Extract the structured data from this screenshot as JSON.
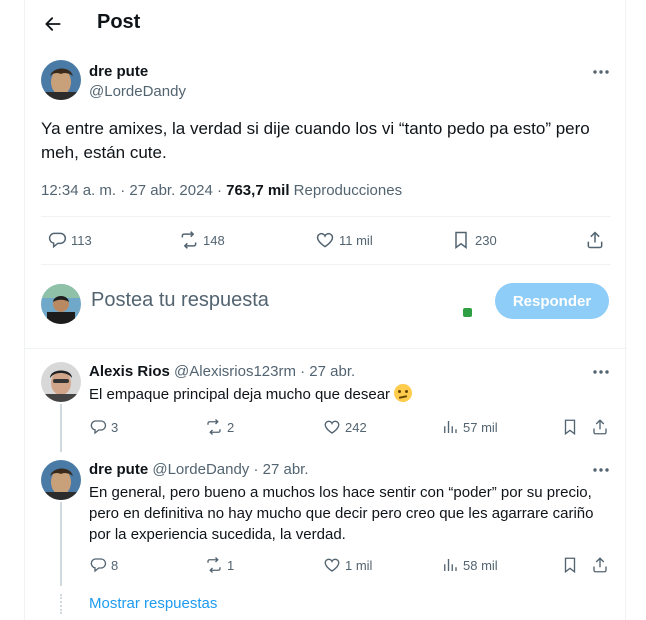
{
  "header": {
    "title": "Post"
  },
  "post": {
    "author_name": "dre pute",
    "author_handle": "@LordeDandy",
    "text": "Ya entre amixes, la verdad si dije cuando los vi “tanto pedo pa esto” pero meh, están cute.",
    "timestamp": "12:34 a. m. · 27 abr. 2024 · ",
    "views_count": "763,7 mil",
    "views_label": " Reproducciones",
    "stats": {
      "replies": "113",
      "reposts": "148",
      "likes": "11 mil",
      "bookmarks": "230"
    }
  },
  "composer": {
    "placeholder": "Postea tu respuesta",
    "button_label": "Responder"
  },
  "replies": [
    {
      "name": "Alexis Rios",
      "handle_date": "@Alexisrios123rm · 27 abr.",
      "text": "El empaque principal deja mucho que desear",
      "stats": {
        "replies": "3",
        "reposts": "2",
        "likes": "242",
        "views": "57 mil"
      }
    },
    {
      "name": "dre pute",
      "handle_date": "@LordeDandy · 27 abr.",
      "text": "En general, pero bueno a muchos los hace sentir con “poder” por su precio, pero en definitiva no hay mucho que decir pero creo que les agarrare cariño por la experiencia sucedida, la verdad.",
      "stats": {
        "replies": "8",
        "reposts": "1",
        "likes": "1 mil",
        "views": "58 mil"
      }
    }
  ],
  "show_replies_label": "Mostrar respuestas"
}
